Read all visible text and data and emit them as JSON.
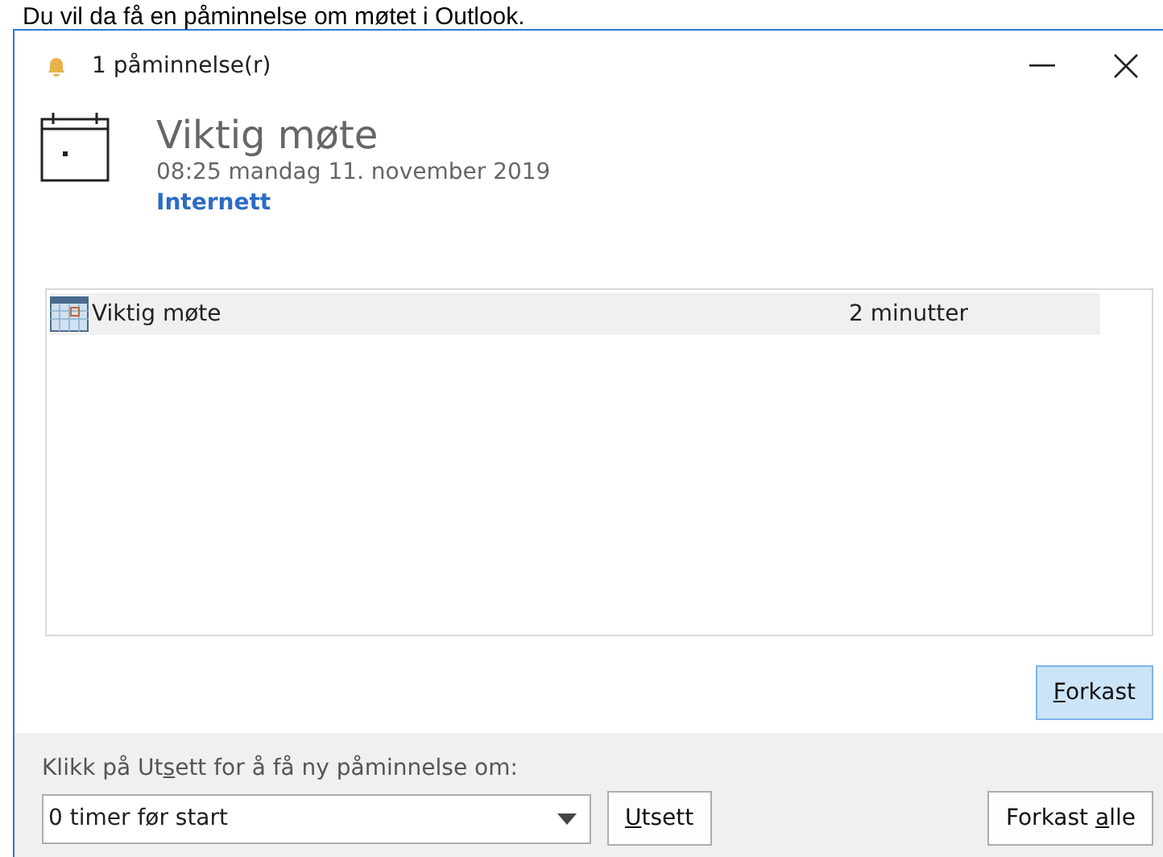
{
  "document_line": "Du vil da få en påminnelse om møtet i Outlook.",
  "window": {
    "title": "1 påminnelse(r)"
  },
  "header": {
    "subject": "Viktig møte",
    "time": "08:25 mandag 11. november 2019",
    "location": "Internett"
  },
  "reminders": [
    {
      "subject": "Viktig møte",
      "due_in": "2 minutter",
      "selected": true
    }
  ],
  "dismiss_button": {
    "access_key": "F",
    "after": "orkast"
  },
  "snooze_hint": {
    "before": "Klikk på Ut",
    "access_key": "s",
    "after": "ett for å få ny påminnelse om:"
  },
  "snooze_dropdown": {
    "value": "0 timer før start"
  },
  "snooze_button": {
    "access_key": "U",
    "after": "tsett"
  },
  "dismiss_all_button": {
    "before": "Forkast ",
    "access_key": "a",
    "after": "lle"
  }
}
